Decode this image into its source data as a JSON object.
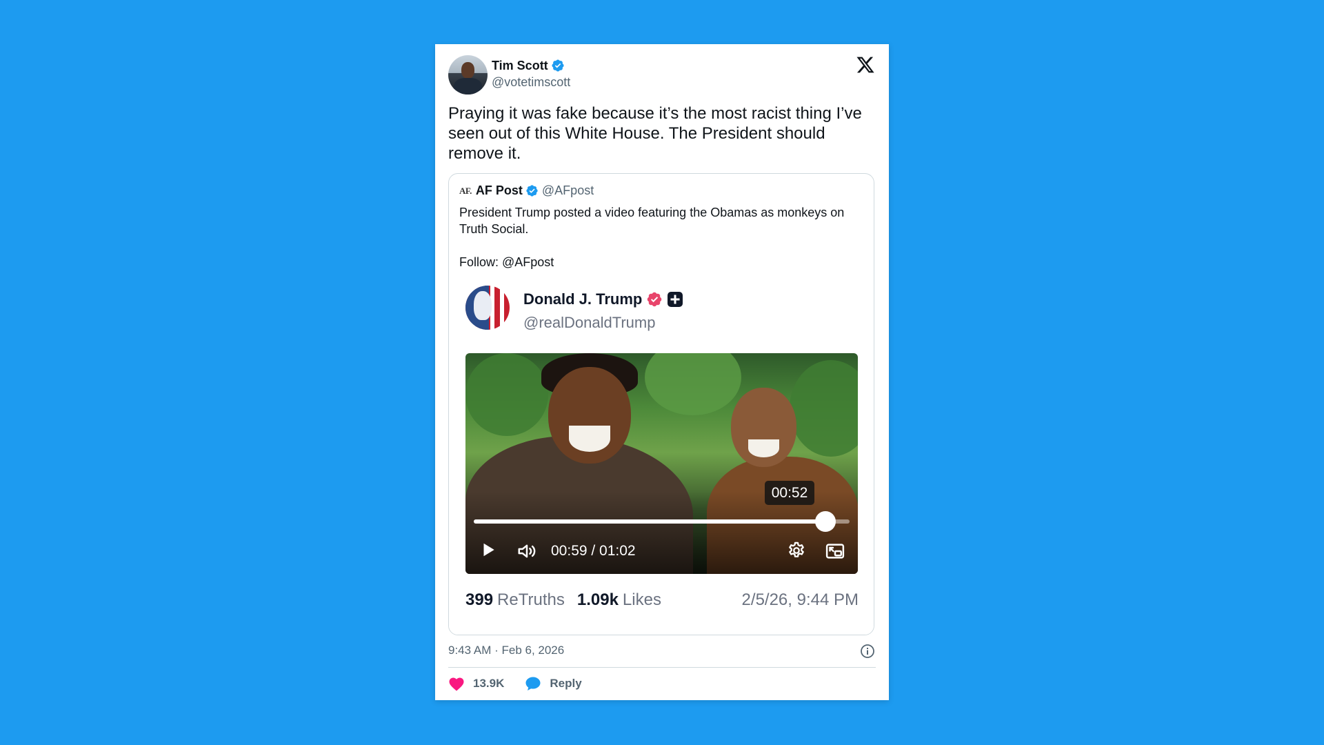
{
  "tweet": {
    "author_name": "Tim Scott",
    "author_handle": "@votetimscott",
    "text": "Praying it was fake because it’s the most racist thing I’ve seen out of this White House. The President should remove it.",
    "timestamp": "9:43 AM · Feb 6, 2026",
    "likes": "13.9K",
    "reply_label": "Reply"
  },
  "quote": {
    "logo_text": "AF.",
    "author_name": "AF Post",
    "author_handle": "@AFpost",
    "text_line1": "President Trump posted a video featuring the Obamas as monkeys on Truth Social.",
    "text_line2": "Follow: @AFpost"
  },
  "truth": {
    "author_name": "Donald J. Trump",
    "author_handle": "@realDonaldTrump",
    "retruths_count": "399",
    "retruths_label": "ReTruths",
    "likes_count": "1.09k",
    "likes_label": "Likes",
    "date": "2/5/26, 9:44 PM"
  },
  "video": {
    "hover_time": "00:52",
    "current_time": "00:59",
    "duration": "01:02",
    "time_display": "00:59 / 01:02",
    "progress": 0.935
  },
  "colors": {
    "background": "#1d9bf0",
    "verified_blue": "#1d9bf0",
    "truth_badge": "#e8456b",
    "like_pink": "#f91880"
  },
  "icons": {
    "verified": "verified-badge-icon",
    "x_logo": "x-logo-icon",
    "play": "play-icon",
    "volume": "volume-icon",
    "settings": "gear-icon",
    "pip": "picture-in-picture-icon",
    "info": "info-icon",
    "heart": "heart-icon",
    "reply": "reply-bubble-icon"
  }
}
